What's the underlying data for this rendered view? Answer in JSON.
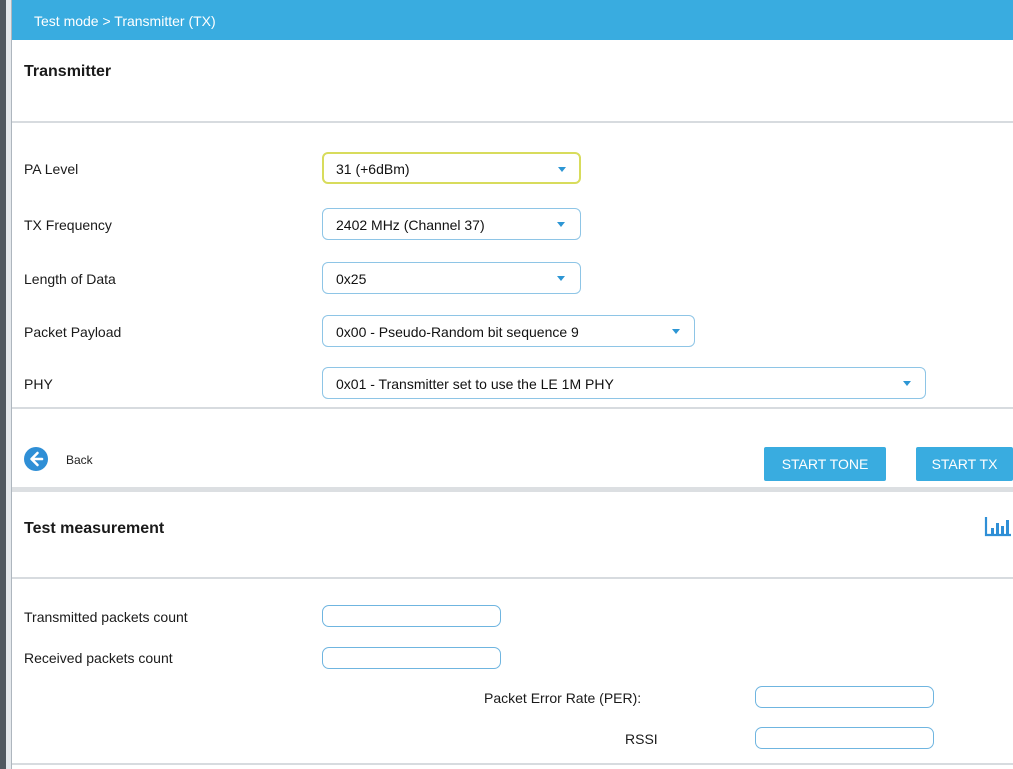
{
  "breadcrumb": "Test mode  >  Transmitter (TX)",
  "transmitter": {
    "title": "Transmitter",
    "fields": [
      {
        "label": "PA Level",
        "value": "31 (+6dBm)"
      },
      {
        "label": "TX Frequency",
        "value": "2402 MHz (Channel 37)"
      },
      {
        "label": "Length of Data",
        "value": "0x25"
      },
      {
        "label": "Packet Payload",
        "value": "0x00 - Pseudo-Random bit sequence 9"
      },
      {
        "label": "PHY",
        "value": "0x01 - Transmitter  set to use the LE 1M PHY"
      }
    ]
  },
  "actions": {
    "back_label": "Back",
    "start_tone_label": "START TONE",
    "start_tx_label": "START TX"
  },
  "measurement": {
    "title": "Test measurement",
    "transmitted_label": "Transmitted packets count",
    "transmitted_value": "",
    "received_label": "Received packets count",
    "received_value": "",
    "per_label": "Packet Error Rate (PER):",
    "per_value": "",
    "rssi_label": "RSSI",
    "rssi_value": ""
  },
  "colors": {
    "accent": "#39ace0",
    "field_border": "#8ec5e6",
    "focus_border": "#d8dc5c"
  },
  "icons": [
    "back-arrow-icon",
    "chevron-down-icon",
    "bar-chart-icon"
  ]
}
